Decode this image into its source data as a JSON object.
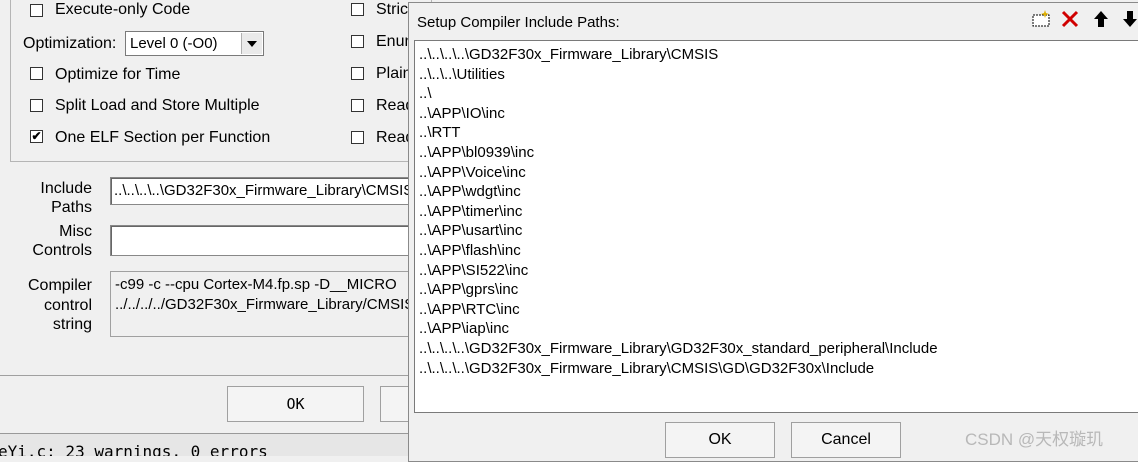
{
  "options": {
    "execute_only_code": {
      "label": "Execute-only Code",
      "checked": false
    },
    "optimization_label": "Optimization:",
    "optimization_value": "Level 0 (-O0)",
    "optimize_for_time": {
      "label": "Optimize for Time",
      "checked": false
    },
    "split_load_store": {
      "label": "Split Load and Store Multiple",
      "checked": false
    },
    "one_elf_section": {
      "label": "One ELF Section per Function",
      "checked": true,
      "mark": "✔"
    },
    "right_column": [
      "Strict",
      "Enum",
      "Plain",
      "Read",
      "Read"
    ]
  },
  "include_paths": {
    "label_line1": "Include",
    "label_line2": "Paths",
    "value": "..\\..\\..\\..\\GD32F30x_Firmware_Library\\CMSIS"
  },
  "misc_controls": {
    "label_line1": "Misc",
    "label_line2": "Controls",
    "value": ""
  },
  "compiler_control": {
    "label_line1": "Compiler",
    "label_line2": "control",
    "label_line3": "string",
    "line1": "-c99 -c --cpu Cortex-M4.fp.sp -D__MICRO",
    "line2": "../../../../GD32F30x_Firmware_Library/CMSIS"
  },
  "main_ok_label": "OK",
  "build_output": "eYi.c: 23 warnings, 0 errors",
  "dialog": {
    "title": "Setup Compiler Include Paths:",
    "toolbar": {
      "new_icon": "new-folder-icon",
      "delete_icon": "delete-x-icon",
      "up_icon": "move-up-icon",
      "down_icon": "move-down-icon",
      "delete_color": "#d00000"
    },
    "paths": [
      "..\\..\\..\\..\\GD32F30x_Firmware_Library\\CMSIS",
      "..\\..\\..\\Utilities",
      "..\\",
      "..\\APP\\IO\\inc",
      "..\\RTT",
      "..\\APP\\bl0939\\inc",
      "..\\APP\\Voice\\inc",
      "..\\APP\\wdgt\\inc",
      "..\\APP\\timer\\inc",
      "..\\APP\\usart\\inc",
      "..\\APP\\flash\\inc",
      "..\\APP\\SI522\\inc",
      "..\\APP\\gprs\\inc",
      "..\\APP\\RTC\\inc",
      "..\\APP\\iap\\inc",
      "..\\..\\..\\..\\GD32F30x_Firmware_Library\\GD32F30x_standard_peripheral\\Include",
      "..\\..\\..\\..\\GD32F30x_Firmware_Library\\CMSIS\\GD\\GD32F30x\\Include"
    ],
    "ok_label": "OK",
    "cancel_label": "Cancel"
  },
  "watermark": "CSDN @天权璇玑"
}
